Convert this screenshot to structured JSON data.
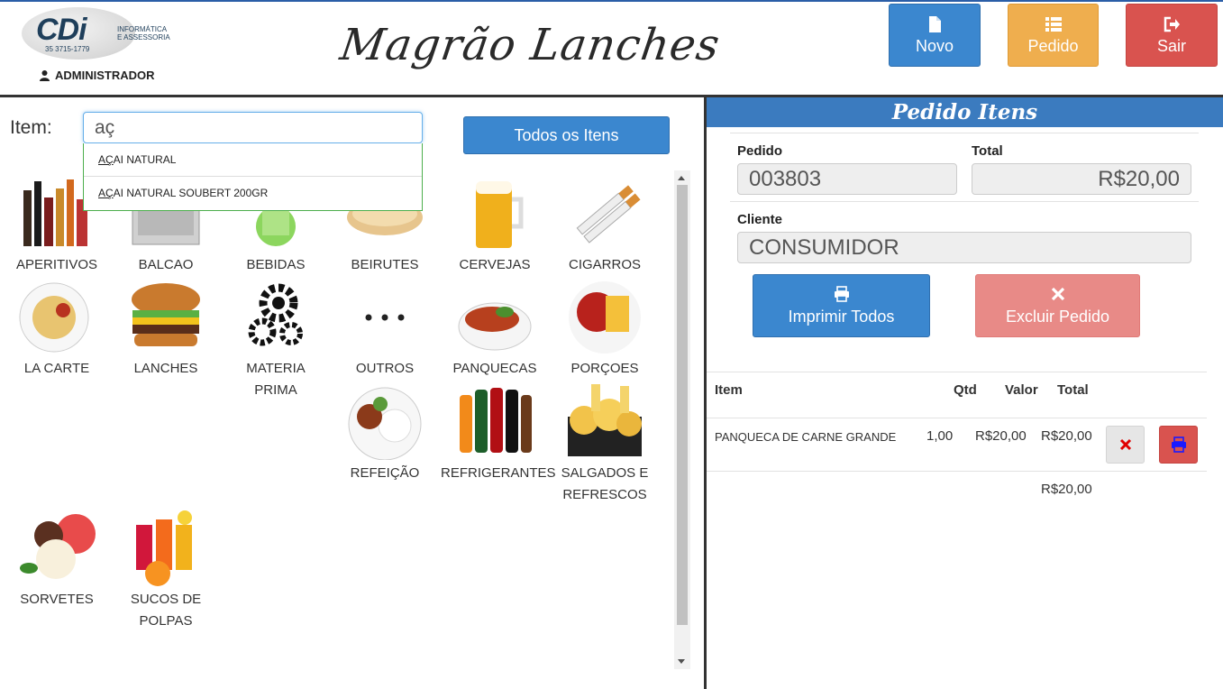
{
  "header": {
    "logo": {
      "word": "CDi",
      "sub": "INFORMÁTICA\nE ASSESSORIA",
      "phone": "35 3715-1779"
    },
    "user": "ADMINISTRADOR",
    "brand": "Magrão Lanches",
    "buttons": {
      "novo": "Novo",
      "pedido": "Pedido",
      "sair": "Sair"
    }
  },
  "search": {
    "label": "Item:",
    "value": "aç",
    "todos": "Todos os Itens",
    "suggestions": [
      {
        "match": "AÇ",
        "rest": "AI NATURAL"
      },
      {
        "match": "AÇ",
        "rest": "AI NATURAL SOUBERT 200GR"
      }
    ]
  },
  "categories": [
    {
      "label": "APERITIVOS",
      "icon": "bottles-icon"
    },
    {
      "label": "BALCAO",
      "icon": "counter-icon"
    },
    {
      "label": "BEBIDAS",
      "icon": "drink-icon"
    },
    {
      "label": "BEIRUTES",
      "icon": "sandwich-icon"
    },
    {
      "label": "CERVEJAS",
      "icon": "beer-icon"
    },
    {
      "label": "CIGARROS",
      "icon": "cigarettes-icon"
    },
    {
      "label": "LA CARTE",
      "icon": "pasta-plate-icon"
    },
    {
      "label": "LANCHES",
      "icon": "burger-icon"
    },
    {
      "label": "MATERIA\nPRIMA",
      "icon": "gears-icon"
    },
    {
      "label": "OUTROS",
      "icon": "dots-icon"
    },
    {
      "label": "PANQUECAS",
      "icon": "pancake-icon"
    },
    {
      "label": "PORÇOES",
      "icon": "portions-icon"
    },
    {
      "label": "REFEIÇÃO",
      "icon": "meal-icon"
    },
    {
      "label": "REFRIGERANTES",
      "icon": "sodas-icon"
    },
    {
      "label": "SALGADOS E\nREFRESCOS",
      "icon": "snacks-icon"
    },
    {
      "label": "SORVETES",
      "icon": "icecream-icon"
    },
    {
      "label": "SUCOS DE\nPOLPAS",
      "icon": "juice-icon"
    }
  ],
  "order": {
    "title": "Pedido Itens",
    "pedido_label": "Pedido",
    "pedido_value": "003803",
    "total_label": "Total",
    "total_value": "R$20,00",
    "cliente_label": "Cliente",
    "cliente_value": "CONSUMIDOR",
    "print_all": "Imprimir Todos",
    "delete_order": "Excluir Pedido",
    "columns": {
      "item": "Item",
      "qtd": "Qtd",
      "valor": "Valor",
      "total": "Total"
    },
    "rows": [
      {
        "item": "PANQUECA DE CARNE GRANDE",
        "qtd": "1,00",
        "valor": "R$20,00",
        "total": "R$20,00"
      }
    ],
    "sum": "R$20,00"
  },
  "colors": {
    "primary": "#3b87cf",
    "warning": "#efae4e",
    "danger": "#d9534f",
    "header_bar": "#3b7bbf"
  }
}
